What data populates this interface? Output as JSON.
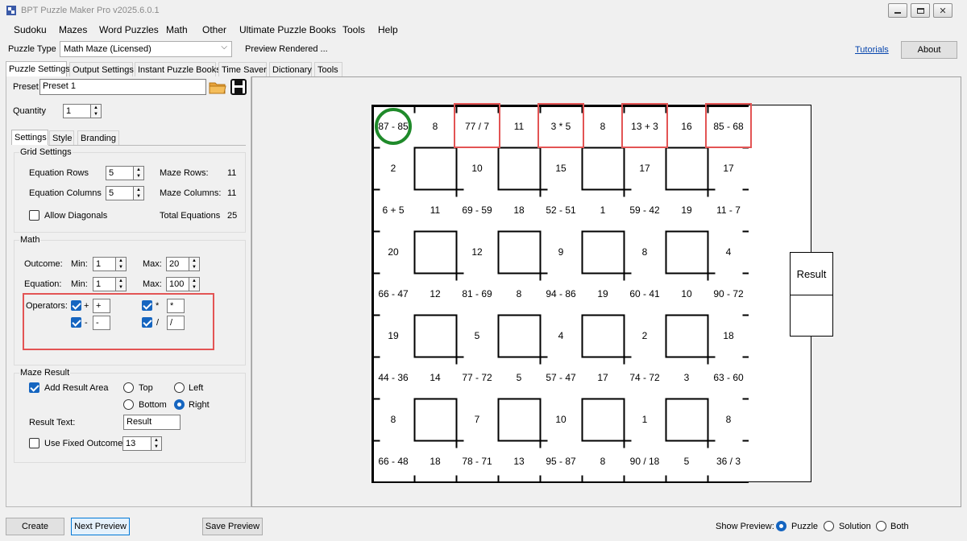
{
  "window": {
    "title": "BPT Puzzle Maker Pro v2025.6.0.1"
  },
  "menu": [
    "Sudoku",
    "Mazes",
    "Word Puzzles",
    "Math",
    "Other",
    "Ultimate Puzzle Books",
    "Tools",
    "Help"
  ],
  "puzzle_type": {
    "label": "Puzzle Type",
    "value": "Math Maze (Licensed)",
    "status": "Preview Rendered ..."
  },
  "links": {
    "tutorials": "Tutorials",
    "about": "About"
  },
  "main_tabs": [
    "Puzzle Settings",
    "Output Settings",
    "Instant Puzzle Books",
    "Time Saver",
    "Dictionary",
    "Tools"
  ],
  "preset": {
    "label": "Preset",
    "value": "Preset 1"
  },
  "quantity": {
    "label": "Quantity",
    "value": "1"
  },
  "sub_tabs": [
    "Settings",
    "Style",
    "Branding"
  ],
  "grid_settings": {
    "title": "Grid Settings",
    "eq_rows_label": "Equation Rows",
    "eq_rows": "5",
    "eq_cols_label": "Equation Columns",
    "eq_cols": "5",
    "maze_rows_label": "Maze Rows:",
    "maze_rows": "11",
    "maze_cols_label": "Maze Columns:",
    "maze_cols": "11",
    "diag_label": "Allow Diagonals",
    "total_label": "Total Equations",
    "total": "25"
  },
  "math": {
    "title": "Math",
    "outcome_label": "Outcome:",
    "equation_label": "Equation:",
    "min_label": "Min:",
    "max_label": "Max:",
    "outcome_min": "1",
    "outcome_max": "20",
    "equation_min": "1",
    "equation_max": "100",
    "operators_label": "Operators:",
    "ops": [
      {
        "sym": "+",
        "val": "+"
      },
      {
        "sym": "*",
        "val": "*"
      },
      {
        "sym": "-",
        "val": "-"
      },
      {
        "sym": "/",
        "val": "/"
      }
    ]
  },
  "maze_result": {
    "title": "Maze Result",
    "add_label": "Add Result Area",
    "top": "Top",
    "left": "Left",
    "bottom": "Bottom",
    "right": "Right",
    "result_text_label": "Result Text:",
    "result_text": "Result",
    "fixed_label": "Use Fixed Outcome",
    "fixed_value": "13"
  },
  "maze": {
    "result_label": "Result",
    "rows": [
      [
        "87 - 85",
        "8",
        "77 / 7",
        "11",
        "3 * 5",
        "8",
        "13 + 3",
        "16",
        "85 - 68"
      ],
      [
        "2",
        "",
        "10",
        "",
        "15",
        "",
        "17",
        "",
        "17"
      ],
      [
        "6 + 5",
        "11",
        "69 - 59",
        "18",
        "52 - 51",
        "1",
        "59 - 42",
        "19",
        "11 - 7"
      ],
      [
        "20",
        "",
        "12",
        "",
        "9",
        "",
        "8",
        "",
        "4"
      ],
      [
        "66 - 47",
        "12",
        "81 - 69",
        "8",
        "94 - 86",
        "19",
        "60 - 41",
        "10",
        "90 - 72"
      ],
      [
        "19",
        "",
        "5",
        "",
        "4",
        "",
        "2",
        "",
        "18"
      ],
      [
        "44 - 36",
        "14",
        "77 - 72",
        "5",
        "57 - 47",
        "17",
        "74 - 72",
        "3",
        "63 - 60"
      ],
      [
        "8",
        "",
        "7",
        "",
        "10",
        "",
        "1",
        "",
        "8"
      ],
      [
        "66 - 48",
        "18",
        "78 - 71",
        "13",
        "95 - 87",
        "8",
        "90 / 18",
        "5",
        "36 / 3"
      ]
    ]
  },
  "bottom": {
    "create": "Create",
    "next": "Next Preview",
    "save": "Save Preview",
    "show_label": "Show Preview:",
    "puzzle": "Puzzle",
    "solution": "Solution",
    "both": "Both"
  }
}
